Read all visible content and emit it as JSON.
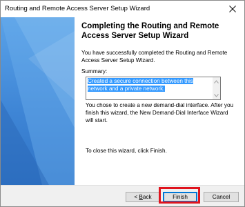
{
  "window": {
    "title": "Routing and Remote Access Server Setup Wizard"
  },
  "content": {
    "heading": "Completing the Routing and Remote Access Server Setup Wizard",
    "intro": "You have successfully completed the Routing and Remote Access Server Setup Wizard.",
    "summary_label": "Summary:",
    "summary_text": "Created a secure connection between this network and a private network.",
    "demand_dial_text": "You chose to create a new demand-dial interface. After you finish this wizard, the New Demand-Dial Interface Wizard will start.",
    "close_text": "To close this wizard, click Finish."
  },
  "buttons": {
    "back_prefix": "< ",
    "back_underlined": "B",
    "back_rest": "ack",
    "finish": "Finish",
    "cancel": "Cancel"
  },
  "colors": {
    "banner": "#3f86d6",
    "selection": "#3399ff",
    "highlight": "#e0141e",
    "focus": "#0078d7"
  },
  "icons": {
    "close": "close-icon",
    "scroll_up": "chevron-up-icon",
    "scroll_down": "chevron-down-icon"
  }
}
